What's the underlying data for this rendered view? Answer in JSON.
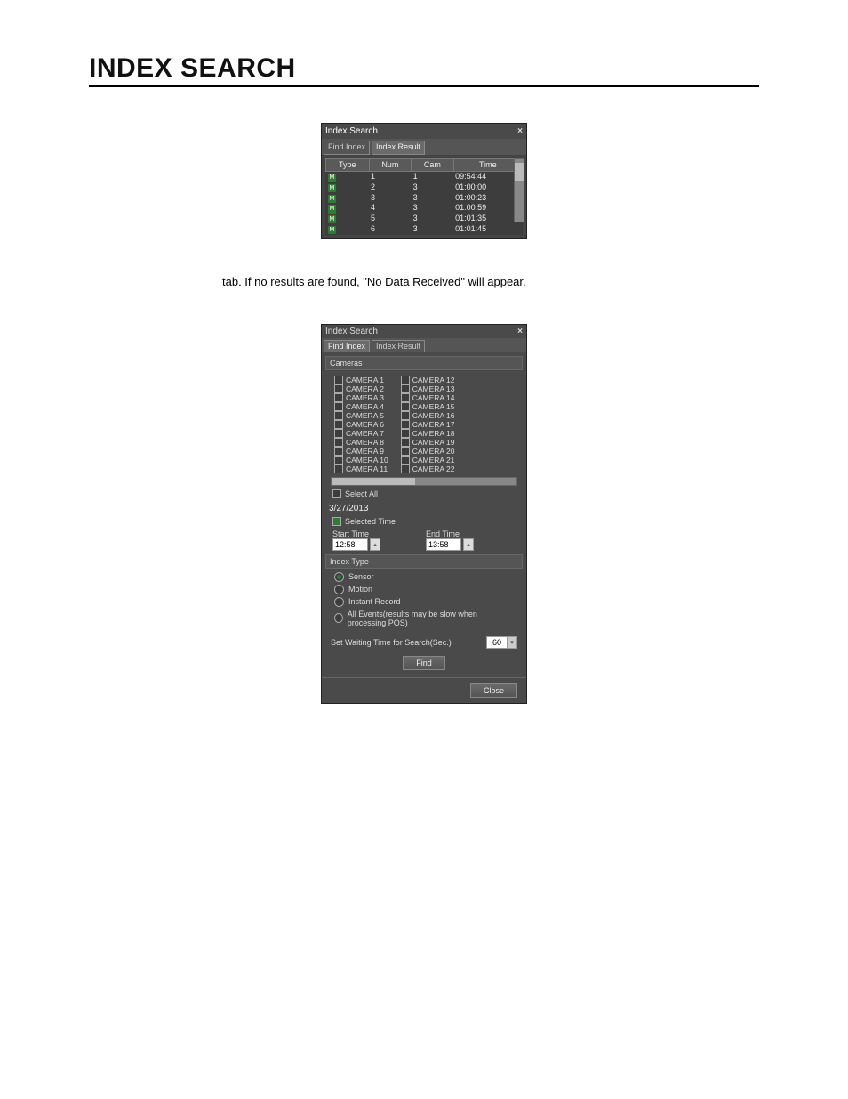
{
  "page": {
    "title": "INDEX SEARCH",
    "body_line": "tab. If no results are found, \"No Data Received\" will appear."
  },
  "result_window": {
    "title": "Index Search",
    "tab_find": "Find Index",
    "tab_result": "Index Result",
    "columns": {
      "type": "Type",
      "num": "Num",
      "cam": "Cam",
      "time": "Time"
    },
    "rows": [
      {
        "num": "1",
        "cam": "1",
        "time": "09:54:44"
      },
      {
        "num": "2",
        "cam": "3",
        "time": "01:00:00"
      },
      {
        "num": "3",
        "cam": "3",
        "time": "01:00:23"
      },
      {
        "num": "4",
        "cam": "3",
        "time": "01:00:59"
      },
      {
        "num": "5",
        "cam": "3",
        "time": "01:01:35"
      },
      {
        "num": "6",
        "cam": "3",
        "time": "01:01:45"
      }
    ]
  },
  "find_window": {
    "title": "Index Search",
    "tab_find": "Find Index",
    "tab_result": "Index Result",
    "cameras_label": "Cameras",
    "cameras_col1": [
      "CAMERA 1",
      "CAMERA 2",
      "CAMERA 3",
      "CAMERA 4",
      "CAMERA 5",
      "CAMERA 6",
      "CAMERA 7",
      "CAMERA 8",
      "CAMERA 9",
      "CAMERA 10",
      "CAMERA 11"
    ],
    "cameras_col2": [
      "CAMERA 12",
      "CAMERA 13",
      "CAMERA 14",
      "CAMERA 15",
      "CAMERA 16",
      "CAMERA 17",
      "CAMERA 18",
      "CAMERA 19",
      "CAMERA 20",
      "CAMERA 21",
      "CAMERA 22"
    ],
    "select_all": "Select All",
    "date": "3/27/2013",
    "selected_time_label": "Selected Time",
    "start_time_label": "Start Time",
    "end_time_label": "End Time",
    "start_time_value": "12:58",
    "end_time_value": "13:58",
    "index_type_label": "Index Type",
    "radio_sensor": "Sensor",
    "radio_motion": "Motion",
    "radio_instant": "Instant Record",
    "radio_all": "All Events(results may be slow when processing POS)",
    "wait_label": "Set Waiting Time for Search(Sec.)",
    "wait_value": "60",
    "find_button": "Find",
    "close_button": "Close"
  }
}
